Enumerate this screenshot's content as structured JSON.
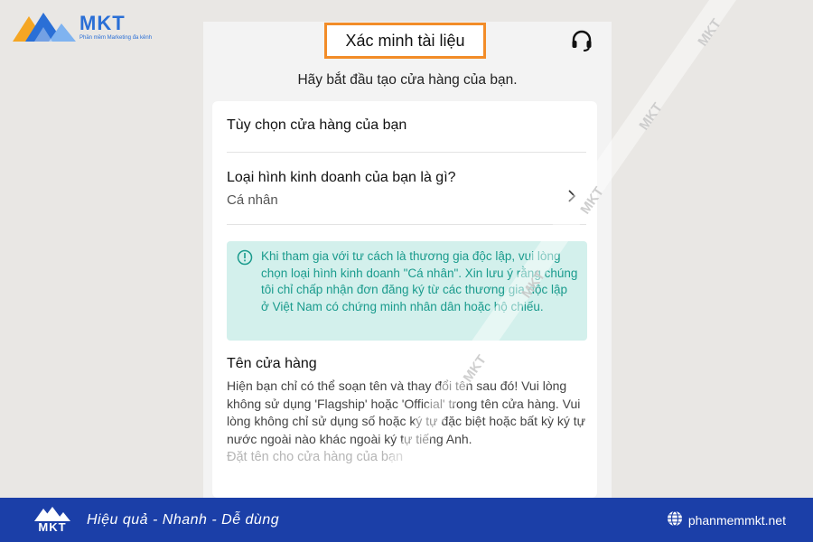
{
  "brand": {
    "name": "MKT",
    "tagline": "Phần mềm Marketing đa kênh",
    "slogan": "Hiệu quả - Nhanh - Dễ dùng",
    "website": "phanmemmkt.net",
    "watermark": "MKT",
    "color": "#2a6fd6"
  },
  "header": {
    "title": "Xác minh tài liệu",
    "support_icon": "headset-icon",
    "highlight_color": "#f28c28"
  },
  "subtitle": "Hãy bắt đầu tạo cửa hàng của bạn.",
  "form": {
    "section_title": "Tùy chọn cửa hàng của bạn",
    "business_type": {
      "question": "Loại hình kinh doanh của bạn là gì?",
      "value": "Cá nhân"
    },
    "info": {
      "icon": "info-circle-icon",
      "text": "Khi tham gia với tư cách là thương gia độc lập, vui lòng chọn loại hình kinh doanh \"Cá nhân\". Xin lưu ý rằng chúng tôi chỉ chấp nhận đơn đăng ký từ các thương gia độc lập ở Việt Nam có chứng minh nhân dân hoặc hộ chiếu.",
      "color": "#1a9b8d"
    },
    "store_name": {
      "label": "Tên cửa hàng",
      "help": "Hiện bạn chỉ có thể soạn tên và thay đổi tên sau đó! Vui lòng không sử dụng 'Flagship' hoặc 'Official' trong tên cửa hàng. Vui lòng không chỉ sử dụng số hoặc ký tự đặc biệt hoặc bất kỳ ký tự nước ngoài nào khác ngoài ký tự tiếng Anh.",
      "placeholder": "Đặt tên cho cửa hàng của bạn"
    }
  },
  "footer_color": "#1b3fa8"
}
